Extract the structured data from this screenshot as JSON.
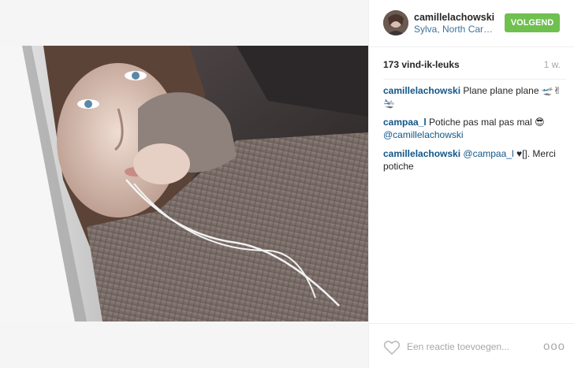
{
  "post": {
    "username": "camillelachowski",
    "location": "Sylva, North Carolina",
    "follow_label": "VOLGEND",
    "likes": "173 vind-ik-leuks",
    "age": "1 w.",
    "comments": [
      {
        "user": "camillelachowski",
        "text": "Plane plane plane 🛫✌🛬"
      },
      {
        "user": "campaa_l",
        "text": "Potiche pas mal pas mal 😎",
        "mention": "@camillelachowski"
      },
      {
        "user": "camillelachowski",
        "mention": "@campaa_l",
        "text": "♥[]. Merci potiche"
      }
    ],
    "comment_placeholder": "Een reactie toevoegen...",
    "more_label": "ooo"
  },
  "colors": {
    "follow_green": "#70c050",
    "link_blue": "#125688",
    "location_blue": "#3f729b",
    "muted_gray": "#a5a7aa"
  },
  "icons": [
    "heart-icon",
    "more-options-icon",
    "avatar"
  ]
}
